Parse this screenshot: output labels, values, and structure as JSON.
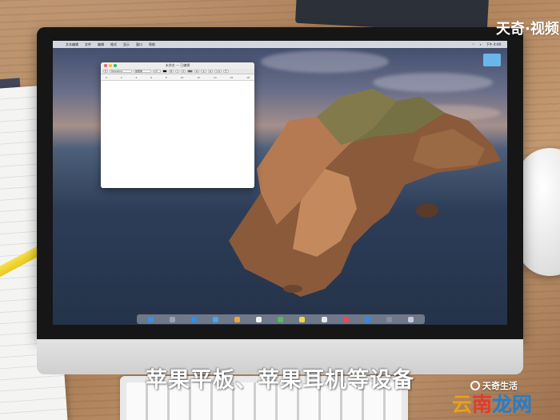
{
  "overlay": {
    "top_watermark": "天奇·视频",
    "subtitle": "苹果平板、苹果耳机等设备",
    "brand_small": "天奇生活",
    "site_mark": {
      "part1": "云",
      "part2": "南",
      "part3": "龙网"
    }
  },
  "menubar": {
    "apple_icon": "apple-icon",
    "items": [
      "文本编辑",
      "文件",
      "编辑",
      "格式",
      "显示",
      "窗口",
      "帮助"
    ],
    "clock": "下午 4:49"
  },
  "textedit_window": {
    "title": "未命名 — 已编辑",
    "font_family": "Helvetica",
    "font_style": "常规体",
    "font_size": "12",
    "ruler_marks": [
      "0",
      "2",
      "4",
      "6",
      "8",
      "10",
      "12",
      "14",
      "16",
      "18"
    ]
  },
  "desktop": {
    "folder_icon": "folder-icon"
  },
  "dock": {
    "icons": [
      "finder",
      "launchpad",
      "safari",
      "mail",
      "photos",
      "calendar",
      "maps",
      "notes",
      "reminders",
      "music",
      "appstore",
      "settings",
      "trash"
    ]
  },
  "colors": {
    "window_close": "#fe5f57",
    "window_minimize": "#febc2e",
    "window_zoom": "#28c840",
    "site_mark_1": "#e8a216",
    "site_mark_2": "#e23b2e",
    "site_mark_3": "#1f7fd0"
  }
}
